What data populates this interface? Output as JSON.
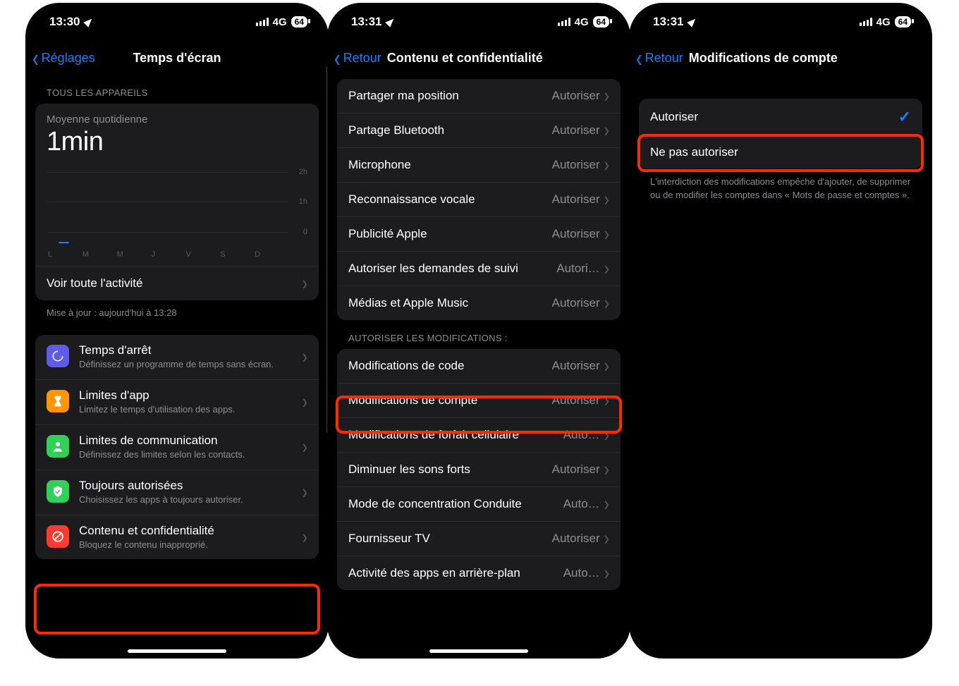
{
  "status": {
    "time1": "13:30",
    "time2": "13:31",
    "time3": "13:31",
    "net": "4G",
    "batt": "64"
  },
  "s1": {
    "back": "Réglages",
    "title": "Temps d'écran",
    "secHeader": "TOUS LES APPAREILS",
    "avgLabel": "Moyenne quotidienne",
    "avgVal": "1min",
    "gridLabels": [
      "2h",
      "1h",
      "0"
    ],
    "days": [
      "L",
      "M",
      "M",
      "J",
      "V",
      "S",
      "D"
    ],
    "seeAll": "Voir toute l'activité",
    "updated": "Mise à jour : aujourd'hui à 13:28",
    "menu": [
      {
        "icon": "moon",
        "title": "Temps d'arrêt",
        "sub": "Définissez un programme de temps sans écran."
      },
      {
        "icon": "hour",
        "title": "Limites d'app",
        "sub": "Limitez le temps d'utilisation des apps."
      },
      {
        "icon": "comm",
        "title": "Limites de communication",
        "sub": "Définissez des limites selon les contacts."
      },
      {
        "icon": "allow",
        "title": "Toujours autorisées",
        "sub": "Choisissez les apps à toujours autoriser."
      },
      {
        "icon": "priv",
        "title": "Contenu et confidentialité",
        "sub": "Bloquez le contenu inapproprié."
      }
    ]
  },
  "s2": {
    "back": "Retour",
    "title": "Contenu et confidentialité",
    "group1": [
      {
        "label": "Partager ma position",
        "value": "Autoriser"
      },
      {
        "label": "Partage Bluetooth",
        "value": "Autoriser"
      },
      {
        "label": "Microphone",
        "value": "Autoriser"
      },
      {
        "label": "Reconnaissance vocale",
        "value": "Autoriser"
      },
      {
        "label": "Publicité Apple",
        "value": "Autoriser"
      },
      {
        "label": "Autoriser les demandes de suivi",
        "value": "Autori…"
      },
      {
        "label": "Médias et Apple Music",
        "value": "Autoriser"
      }
    ],
    "secHeader": "AUTORISER LES MODIFICATIONS :",
    "group2": [
      {
        "label": "Modifications de code",
        "value": "Autoriser"
      },
      {
        "label": "Modifications de compte",
        "value": "Autoriser"
      },
      {
        "label": "Modifications de forfait cellulaire",
        "value": "Auto…"
      },
      {
        "label": "Diminuer les sons forts",
        "value": "Autoriser"
      },
      {
        "label": "Mode de concentration Conduite",
        "value": "Auto…"
      },
      {
        "label": "Fournisseur TV",
        "value": "Autoriser"
      },
      {
        "label": "Activité des apps en arrière-plan",
        "value": "Auto…"
      }
    ]
  },
  "s3": {
    "back": "Retour",
    "title": "Modifications de compte",
    "allow": "Autoriser",
    "disallow": "Ne pas autoriser",
    "footer": "L'interdiction des modifications empêche d'ajouter, de supprimer ou de modifier les comptes dans « Mots de passe et comptes »."
  },
  "chart_data": {
    "type": "bar",
    "categories": [
      "L",
      "M",
      "M",
      "J",
      "V",
      "S",
      "D"
    ],
    "values": [
      0.05,
      0,
      0,
      0,
      0,
      0,
      0
    ],
    "ylabel": "hours",
    "ylim": [
      0,
      2
    ],
    "title": "Moyenne quotidienne 1min"
  }
}
